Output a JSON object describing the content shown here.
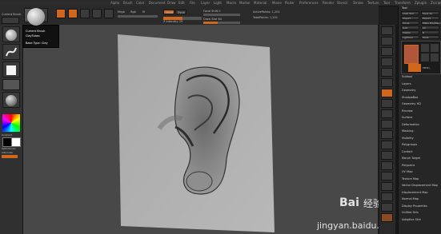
{
  "menu": {
    "items": [
      "Alpha",
      "Brush",
      "Color",
      "Document",
      "Draw",
      "Edit",
      "File",
      "Layer",
      "Light",
      "Macro",
      "Marker",
      "Material",
      "Movie",
      "Picker",
      "Preferences",
      "Render",
      "Stencil",
      "Stroke",
      "Texture",
      "Tool",
      "Transform",
      "Zplugin",
      "Zscript"
    ]
  },
  "toolbar": {
    "current_brush_label": "Current Brush",
    "mrgb": "Mrgb",
    "rgb": "Rgb",
    "m": "M",
    "zadd": "Zadd",
    "zsub": "Zsub",
    "focal_label": "Focal Shift 0",
    "intensity_label": "Z Intensity 25",
    "draw_size_label": "Draw Size 64",
    "active_points": "ActivePoints: 1,201",
    "total_points": "TotalPoints: 1,201"
  },
  "tooltip": {
    "line1": "Current Brush",
    "line2": "ClayTubes",
    "line3": "Base Type: Clay"
  },
  "left_tray": {
    "gradient_label": "Gradient",
    "switch_label": "SwitchColor",
    "alternate_label": "Alternate"
  },
  "tool_panel": {
    "title": "Tool",
    "top_buttons": [
      "Load Tool",
      "Save As",
      "Import",
      "Export",
      "Clone",
      "Make PolyMesh3D",
      "GoZ",
      "All",
      "Visible",
      "R",
      "Lightbox",
      "Tools"
    ],
    "subtool_label": "PM3D_",
    "items": [
      "Subtool",
      "Layers",
      "Geometry",
      "ShadowBox",
      "Geometry HD",
      "Preview",
      "Surface",
      "Deformation",
      "Masking",
      "Visibility",
      "Polygroups",
      "Contact",
      "Morph Target",
      "Polypaint",
      "UV Map",
      "Texture Map",
      "Vector Displacement Map",
      "Displacement Map",
      "Normal Map",
      "Display Properties",
      "Unified Skin",
      "Adaptive Skin"
    ]
  },
  "watermark": {
    "brand": "Bai",
    "brand_cn": "经验",
    "url": "jingyan.baidu.com"
  },
  "colors": {
    "accent": "#d0671d",
    "canvas": "#484848",
    "panel": "#262626"
  }
}
